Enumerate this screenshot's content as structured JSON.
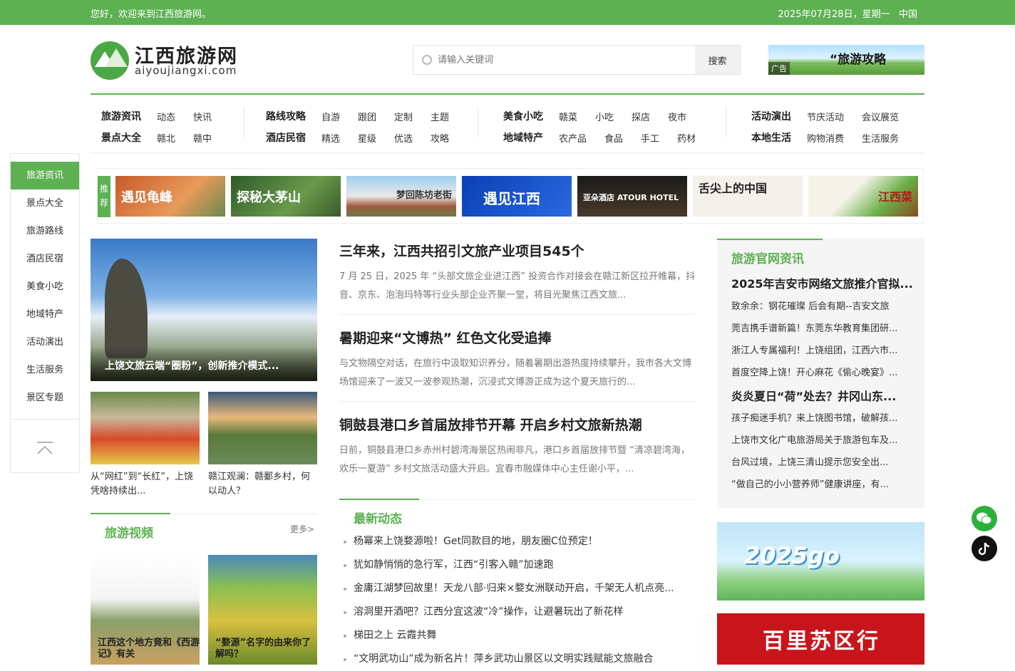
{
  "topbar": {
    "welcome": "您好，欢迎来到江西旅游网。",
    "date": "2025年07月28日，星期一",
    "region": "中国"
  },
  "logo": {
    "cn": "江西旅游网",
    "en": "aiyoujiangxi.com"
  },
  "search": {
    "placeholder": "请输入关键词",
    "button": "搜索"
  },
  "ad": {
    "title": "“旅游攻略",
    "tag": "广告"
  },
  "nav": {
    "g1": {
      "r1": [
        "旅游资讯",
        "动态",
        "快讯"
      ],
      "r2": [
        "景点大全",
        "赣北",
        "赣中"
      ]
    },
    "g2": {
      "r1": [
        "路线攻略",
        "自游",
        "跟团",
        "定制",
        "主题"
      ],
      "r2": [
        "酒店民宿",
        "精选",
        "星级",
        "优选",
        "攻略"
      ]
    },
    "g3": {
      "r1": [
        "美食小吃",
        "赣菜",
        "小吃",
        "探店",
        "夜市"
      ],
      "r2": [
        "地域特产",
        "农产品",
        "食品",
        "手工",
        "药材"
      ]
    },
    "g4": {
      "r1": [
        "活动演出",
        "节庆活动",
        "会议展览"
      ],
      "r2": [
        "本地生活",
        "购物消费",
        "生活服务"
      ]
    }
  },
  "sidebar": [
    "旅游资讯",
    "景点大全",
    "旅游路线",
    "酒店民宿",
    "美食小吃",
    "地域特产",
    "活动演出",
    "生活服务",
    "景区专题"
  ],
  "recommend": {
    "label": "推荐",
    "items": [
      "遇见龟峰",
      "探秘大茅山",
      "梦回陈坊老街",
      "遇见江西",
      "亚朵酒店 ATOUR HOTEL",
      "舌尖上的中国",
      "江西菜"
    ]
  },
  "hero": {
    "caption": "上饶文旅云端“圈粉”，创新推介模式..."
  },
  "thumbs": [
    {
      "caption": "从“网红”到“长红”，上饶凭啥持续出..."
    },
    {
      "caption": "赣江观澜：赣鄱乡村，何以动人？"
    }
  ],
  "video": {
    "title": "旅游视频",
    "more": "更多>",
    "items": [
      "江西这个地方竟和《西游记》有关",
      "“婺源”名字的由来你了解吗？"
    ]
  },
  "articles": [
    {
      "title": "三年来，江西共招引文旅产业项目545个",
      "summary": "7 月 25 日，2025 年 “头部文旅企业进江西” 投资合作对接会在赣江新区拉开帷幕，抖音、京东、泡泡玛特等行业头部企业齐聚一堂，将目光聚焦江西文旅..."
    },
    {
      "title": "暑期迎来“文博热” 红色文化受追捧",
      "summary": "与文物隔空对话，在旅行中汲取知识养分，随着暑期出游热度持续攀升，我市各大文博场馆迎来了一波又一波参观热潮，沉浸式文博游正成为这个夏天旅行的..."
    },
    {
      "title": "铜鼓县港口乡首届放排节开幕 开启乡村文旅新热潮",
      "summary": "日前，铜鼓县港口乡赤州村碧湾海景区热闹非凡，港口乡首届放排节暨 “清凉碧湾海，欢乐一夏游” 乡村文旅活动盛大开启。宜春市融媒体中心主任谢小平，..."
    }
  ],
  "latest": {
    "title": "最新动态",
    "items": [
      "杨幂来上饶婺源啦！Get同款目的地，朋友圈C位预定！",
      "犹如静悄悄的急行军，江西“引客入赣”加速跑",
      "金庸江湖梦回故里！天龙八部·归来×婺女洲联动开启，千架无人机点亮...",
      "溶洞里开酒吧？江西分宜这波“冷”操作，让避暑玩出了新花样",
      "梯田之上 云霞共舞",
      "“文明武功山”成为新名片！萍乡武功山景区以文明实践赋能文旅融合"
    ]
  },
  "official": {
    "title": "旅游官网资讯",
    "items": [
      {
        "text": "2025年吉安市网络文旅推介官拟...",
        "bold": true
      },
      {
        "text": "致余余：钢花璀璨 后会有期--吉安文旅",
        "bold": false
      },
      {
        "text": "莞吉携手谱新篇！东莞东华教育集团研...",
        "bold": false
      },
      {
        "text": "浙江人专属福利！上饶组团，江西六市...",
        "bold": false
      },
      {
        "text": "首度空降上饶！开心麻花《偷心晚宴》...",
        "bold": false
      },
      {
        "text": "炎炎夏日“荷”处去？井冈山东...",
        "bold": true
      },
      {
        "text": "孩子痴迷手机？来上饶图书馆，破解孩...",
        "bold": false
      },
      {
        "text": "上饶市文化广电旅游局关于旅游包车及...",
        "bold": false
      },
      {
        "text": "台风过境，上饶三清山提示您安全出...",
        "bold": false
      },
      {
        "text": "“做自己的小小营养师”健康讲座，有...",
        "bold": false
      }
    ]
  },
  "banner1": {
    "text": "2025go"
  },
  "banner2": {
    "text": "百里苏区行"
  },
  "colors": {
    "brand": "#5db152"
  }
}
